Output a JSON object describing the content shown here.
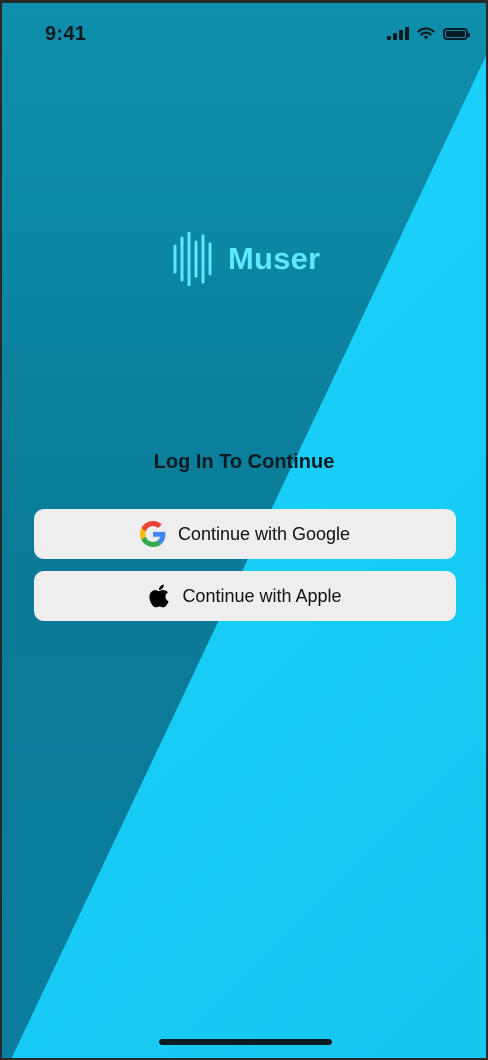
{
  "status_bar": {
    "time": "9:41",
    "icons": [
      "signal-icon",
      "wifi-icon",
      "battery-icon"
    ]
  },
  "brand": {
    "name": "Muser",
    "icon": "soundwave-logo-icon",
    "color": "#5ee7ff"
  },
  "login": {
    "heading": "Log In To Continue",
    "google_button": "Continue with Google",
    "apple_button": "Continue with Apple"
  },
  "colors": {
    "background_light": "#1ad6ff",
    "background_dark": "#0a7a96",
    "button_bg": "#eeeeee"
  }
}
